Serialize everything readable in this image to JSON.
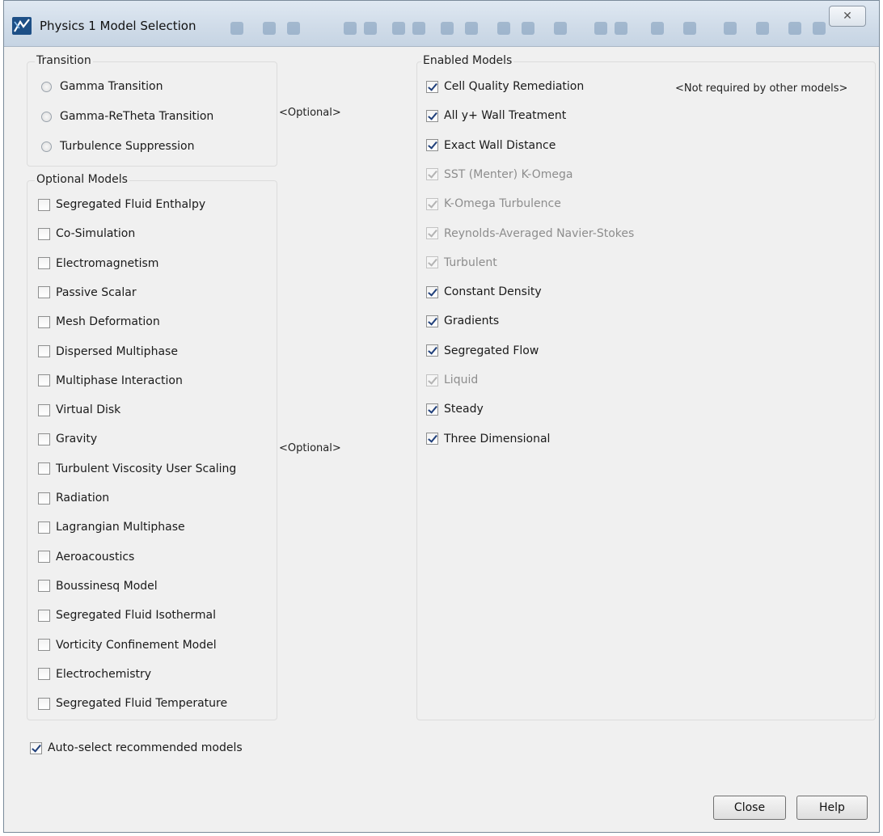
{
  "window": {
    "title": "Physics 1 Model Selection",
    "close_glyph": "✕",
    "icon": "physics-app-icon"
  },
  "transition": {
    "title": "Transition",
    "optional_label": "<Optional>",
    "options": [
      {
        "label": "Gamma Transition",
        "selected": false
      },
      {
        "label": "Gamma-ReTheta Transition",
        "selected": false
      },
      {
        "label": "Turbulence Suppression",
        "selected": false
      }
    ]
  },
  "optional_models": {
    "title": "Optional Models",
    "optional_label": "<Optional>",
    "items": [
      {
        "label": "Segregated Fluid Enthalpy",
        "checked": false
      },
      {
        "label": "Co-Simulation",
        "checked": false
      },
      {
        "label": "Electromagnetism",
        "checked": false
      },
      {
        "label": "Passive Scalar",
        "checked": false
      },
      {
        "label": "Mesh Deformation",
        "checked": false
      },
      {
        "label": "Dispersed Multiphase",
        "checked": false
      },
      {
        "label": "Multiphase Interaction",
        "checked": false
      },
      {
        "label": "Virtual Disk",
        "checked": false
      },
      {
        "label": "Gravity",
        "checked": false
      },
      {
        "label": "Turbulent Viscosity User Scaling",
        "checked": false
      },
      {
        "label": "Radiation",
        "checked": false
      },
      {
        "label": "Lagrangian Multiphase",
        "checked": false
      },
      {
        "label": "Aeroacoustics",
        "checked": false
      },
      {
        "label": "Boussinesq Model",
        "checked": false
      },
      {
        "label": "Segregated Fluid Isothermal",
        "checked": false
      },
      {
        "label": "Vorticity Confinement Model",
        "checked": false
      },
      {
        "label": "Electrochemistry",
        "checked": false
      },
      {
        "label": "Segregated Fluid Temperature",
        "checked": false
      }
    ]
  },
  "enabled_models": {
    "title": "Enabled Models",
    "note": "<Not required by other models>",
    "items": [
      {
        "label": "Cell Quality Remediation",
        "checked": true,
        "disabled": false
      },
      {
        "label": "All y+ Wall Treatment",
        "checked": true,
        "disabled": false
      },
      {
        "label": "Exact Wall Distance",
        "checked": true,
        "disabled": false
      },
      {
        "label": "SST (Menter) K-Omega",
        "checked": true,
        "disabled": true
      },
      {
        "label": "K-Omega Turbulence",
        "checked": true,
        "disabled": true
      },
      {
        "label": "Reynolds-Averaged Navier-Stokes",
        "checked": true,
        "disabled": true
      },
      {
        "label": "Turbulent",
        "checked": true,
        "disabled": true
      },
      {
        "label": "Constant Density",
        "checked": true,
        "disabled": false
      },
      {
        "label": "Gradients",
        "checked": true,
        "disabled": false
      },
      {
        "label": "Segregated Flow",
        "checked": true,
        "disabled": false
      },
      {
        "label": "Liquid",
        "checked": true,
        "disabled": true
      },
      {
        "label": "Steady",
        "checked": true,
        "disabled": false
      },
      {
        "label": "Three Dimensional",
        "checked": true,
        "disabled": false
      }
    ]
  },
  "auto_select": {
    "label": "Auto-select recommended models",
    "checked": true
  },
  "buttons": {
    "close": "Close",
    "help": "Help"
  }
}
